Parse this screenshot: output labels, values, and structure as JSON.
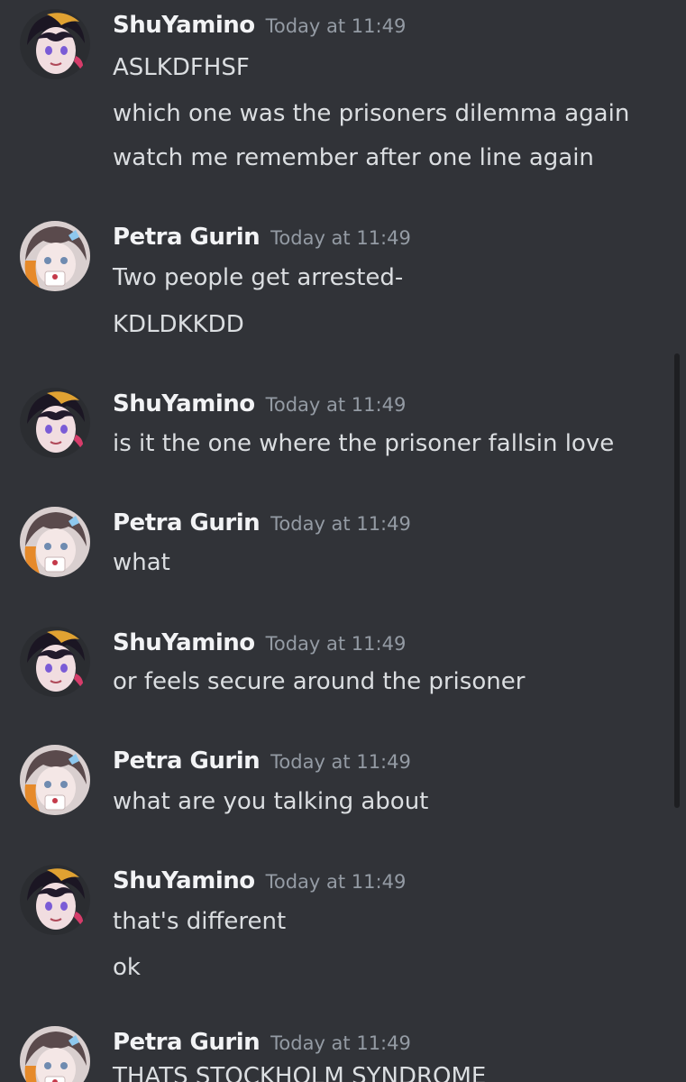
{
  "messages": [
    {
      "author": "ShuYamino",
      "timestamp": "Today at 11:49",
      "avatar": "shu-avatar",
      "lines": [
        "ASLKDFHSF",
        "which one was the prisoners dilemma again",
        "watch me remember after one line again"
      ]
    },
    {
      "author": "Petra Gurin",
      "timestamp": "Today at 11:49",
      "avatar": "petra-avatar",
      "lines": [
        "Two people get arrested-",
        "KDLDKKDD"
      ]
    },
    {
      "author": "ShuYamino",
      "timestamp": "Today at 11:49",
      "avatar": "shu-avatar",
      "lines": [
        "is it the one where the prisoner fallsin love"
      ]
    },
    {
      "author": "Petra Gurin",
      "timestamp": "Today at 11:49",
      "avatar": "petra-avatar",
      "lines": [
        "what"
      ]
    },
    {
      "author": "ShuYamino",
      "timestamp": "Today at 11:49",
      "avatar": "shu-avatar",
      "lines": [
        "or feels secure around the prisoner"
      ]
    },
    {
      "author": "Petra Gurin",
      "timestamp": "Today at 11:49",
      "avatar": "petra-avatar",
      "lines": [
        "what are you talking about"
      ]
    },
    {
      "author": "ShuYamino",
      "timestamp": "Today at 11:49",
      "avatar": "shu-avatar",
      "lines": [
        "that's different",
        "ok"
      ]
    },
    {
      "author": "Petra Gurin",
      "timestamp": "Today at 11:49",
      "avatar": "petra-avatar",
      "lines": [
        "THATS STOCKHOLM SYNDROME"
      ]
    }
  ],
  "colors": {
    "background": "#313338",
    "author": "#f2f3f5",
    "text": "#dbdee1",
    "timestamp": "#949ba4",
    "scrollbar": "#1e1f22"
  }
}
